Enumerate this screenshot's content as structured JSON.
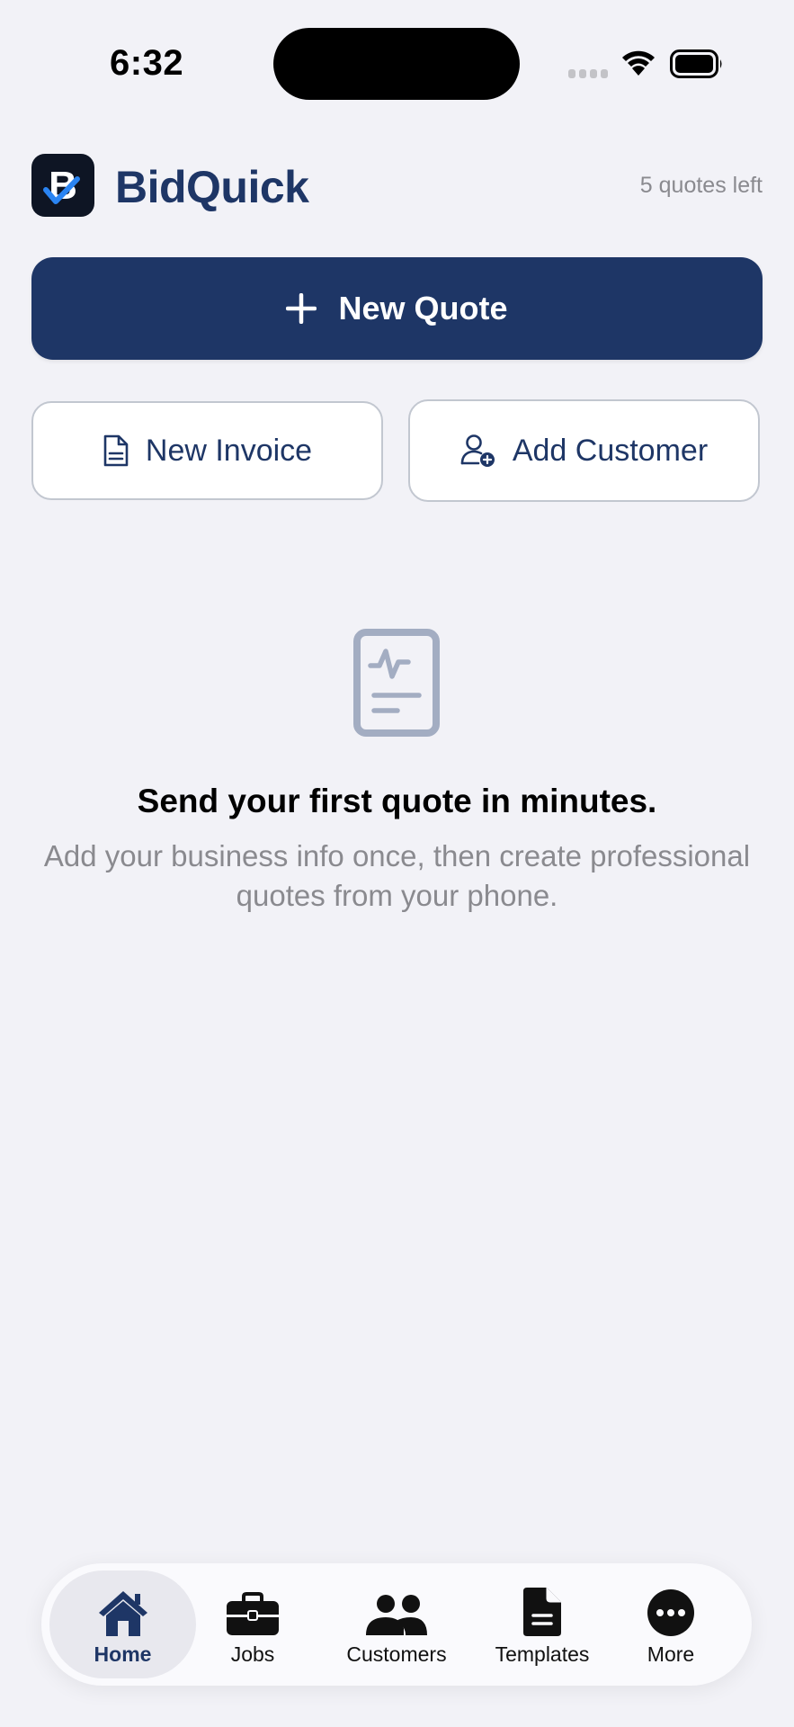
{
  "status": {
    "time": "6:32"
  },
  "header": {
    "app_title": "BidQuick",
    "quota": "5 quotes left",
    "logo_letter": "B"
  },
  "actions": {
    "new_quote": "New Quote",
    "new_invoice": "New Invoice",
    "add_customer": "Add Customer"
  },
  "empty_state": {
    "title": "Send your first quote in minutes.",
    "body": "Add your business info once, then create professional quotes from your phone."
  },
  "tabs": [
    {
      "label": "Home",
      "icon": "home-icon",
      "selected": true
    },
    {
      "label": "Jobs",
      "icon": "briefcase-icon",
      "selected": false
    },
    {
      "label": "Customers",
      "icon": "people-icon",
      "selected": false
    },
    {
      "label": "Templates",
      "icon": "document-icon",
      "selected": false
    },
    {
      "label": "More",
      "icon": "ellipsis-icon",
      "selected": false
    }
  ],
  "colors": {
    "brand": "#1e3666",
    "background": "#f2f2f7",
    "muted": "#8a8a8f",
    "icon_muted": "#a3adc2",
    "check": "#2a84f2"
  }
}
